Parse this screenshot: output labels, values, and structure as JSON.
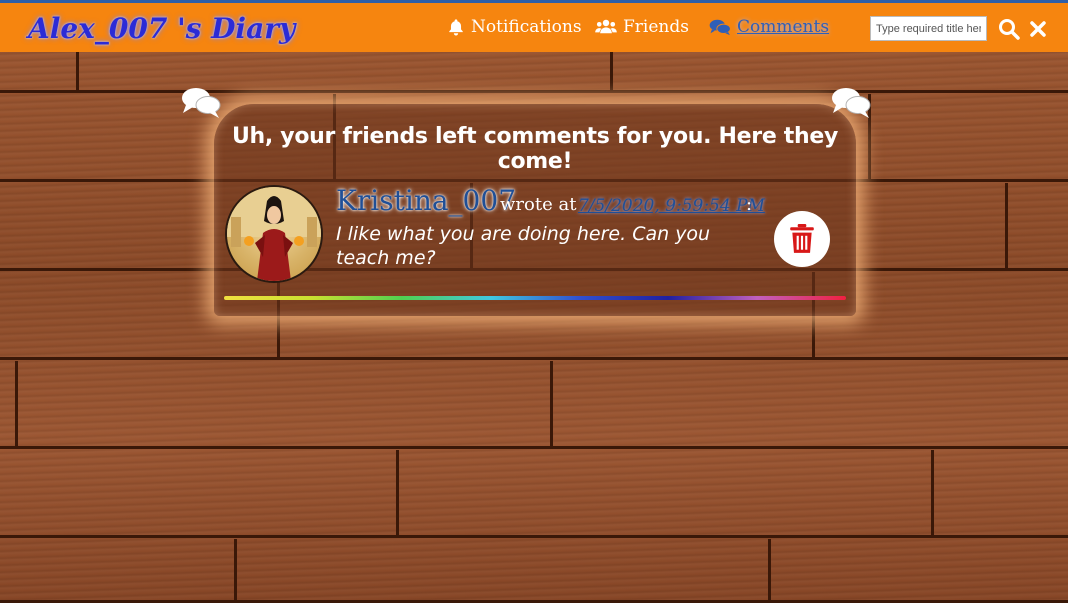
{
  "header": {
    "brand": "Alex_007 's Diary",
    "nav": [
      {
        "label": "Notifications",
        "icon": "bell-icon",
        "active": false
      },
      {
        "label": "Friends",
        "icon": "users-icon",
        "active": false
      },
      {
        "label": "Comments",
        "icon": "comments-icon",
        "active": true
      }
    ],
    "search": {
      "placeholder": "Type required title here",
      "value": ""
    },
    "colors": {
      "bar": "#f6850f",
      "brand": "#2b2bd6",
      "active_nav": "#2f5fb8"
    }
  },
  "comments_panel": {
    "title": "Uh, your friends left comments for you. Here they come!",
    "items": [
      {
        "author": "Kristina_007",
        "wrote_label": "wrote at",
        "timestamp": "7/5/2020, 9:59:54 PM",
        "separator": ":",
        "text": "I like what you are doing here. Can you teach me?"
      }
    ]
  }
}
